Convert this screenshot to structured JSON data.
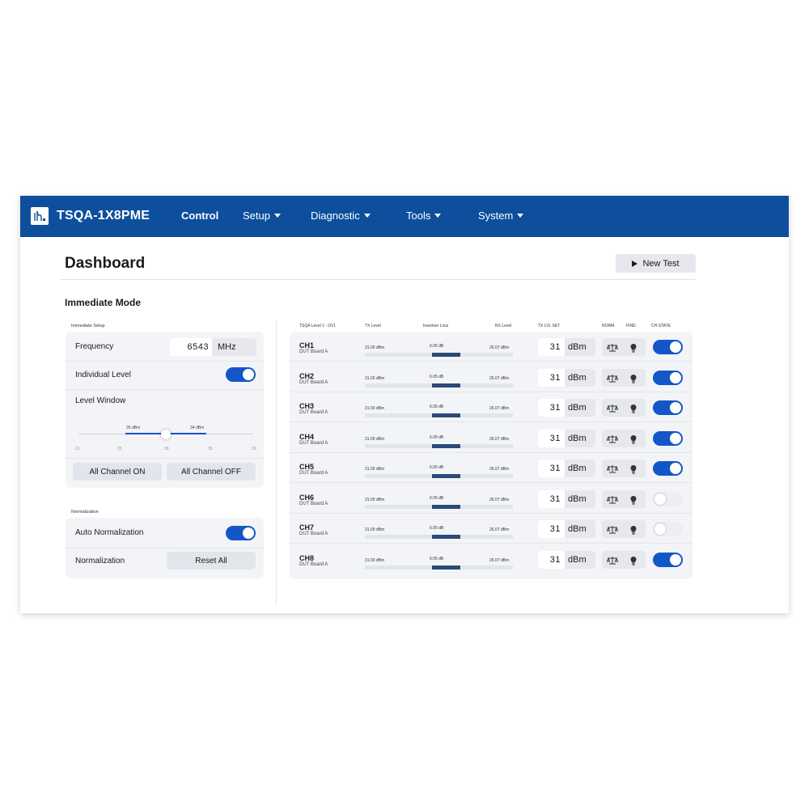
{
  "app": {
    "title": "TSQA-1X8PME"
  },
  "nav": {
    "items": [
      {
        "label": "Control"
      },
      {
        "label": "Setup"
      },
      {
        "label": "Diagnostic"
      },
      {
        "label": "Tools"
      },
      {
        "label": "System"
      }
    ]
  },
  "page": {
    "title": "Dashboard",
    "new_test_label": "New Test",
    "section_title": "Immediate Mode"
  },
  "setup": {
    "heading": "Immediate Setup",
    "frequency_label": "Frequency",
    "frequency_value": "6543",
    "frequency_unit": "MHz",
    "individual_level_label": "Individual Level",
    "individual_level_on": true,
    "level_window_label": "Level Window",
    "level_window_low": "26 dBm",
    "level_window_high": "34 dBm",
    "ticks": [
      "21",
      "25",
      "30",
      "35",
      "39"
    ],
    "all_on_label": "All Channel ON",
    "all_off_label": "All Channel OFF"
  },
  "normalization": {
    "heading": "Normalization",
    "auto_label": "Auto Normalization",
    "auto_on": true,
    "norm_label": "Normalization",
    "reset_label": "Reset All"
  },
  "channels": {
    "headers": {
      "device": "TSQA Level 1 - DV1",
      "tx": "TX Level",
      "il": "Insertion Loss",
      "rx": "RX Level",
      "set": "TX LVL SET",
      "norm": "NORM.",
      "find": "FIND.",
      "state": "CH STATE"
    },
    "rows": [
      {
        "name": "CH1",
        "dut": "DUT Board A",
        "tx": "31.00 dBm",
        "il": "6.05 dB",
        "rx": "26.07 dBm",
        "set": "31",
        "unit": "dBm",
        "on": true
      },
      {
        "name": "CH2",
        "dut": "DUT Board A",
        "tx": "31.00 dBm",
        "il": "6.05 dB",
        "rx": "26.07 dBm",
        "set": "31",
        "unit": "dBm",
        "on": true
      },
      {
        "name": "CH3",
        "dut": "DUT Board A",
        "tx": "31.00 dBm",
        "il": "6.05 dB",
        "rx": "26.07 dBm",
        "set": "31",
        "unit": "dBm",
        "on": true
      },
      {
        "name": "CH4",
        "dut": "DUT Board A",
        "tx": "31.00 dBm",
        "il": "6.05 dB",
        "rx": "26.07 dBm",
        "set": "31",
        "unit": "dBm",
        "on": true
      },
      {
        "name": "CH5",
        "dut": "DUT Board A",
        "tx": "31.00 dBm",
        "il": "6.05 dB",
        "rx": "26.07 dBm",
        "set": "31",
        "unit": "dBm",
        "on": true
      },
      {
        "name": "CH6",
        "dut": "DUT Board A",
        "tx": "31.00 dBm",
        "il": "6.05 dB",
        "rx": "26.07 dBm",
        "set": "31",
        "unit": "dBm",
        "on": false
      },
      {
        "name": "CH7",
        "dut": "DUT Board A",
        "tx": "31.00 dBm",
        "il": "6.05 dB",
        "rx": "26.07 dBm",
        "set": "31",
        "unit": "dBm",
        "on": false
      },
      {
        "name": "CH8",
        "dut": "DUT Board A",
        "tx": "31.00 dBm",
        "il": "6.05 dB",
        "rx": "26.07 dBm",
        "set": "31",
        "unit": "dBm",
        "on": true
      }
    ]
  },
  "icons": {
    "logo": "antenna-logo-icon",
    "play": "play-icon",
    "norm": "balance-scale-icon",
    "find": "lightbulb-icon",
    "caret": "chevron-down-icon"
  },
  "colors": {
    "nav_bg": "#0d4f9c",
    "accent": "#1356c7",
    "bar": "#2a4a78",
    "card_bg": "#f3f4f7"
  }
}
